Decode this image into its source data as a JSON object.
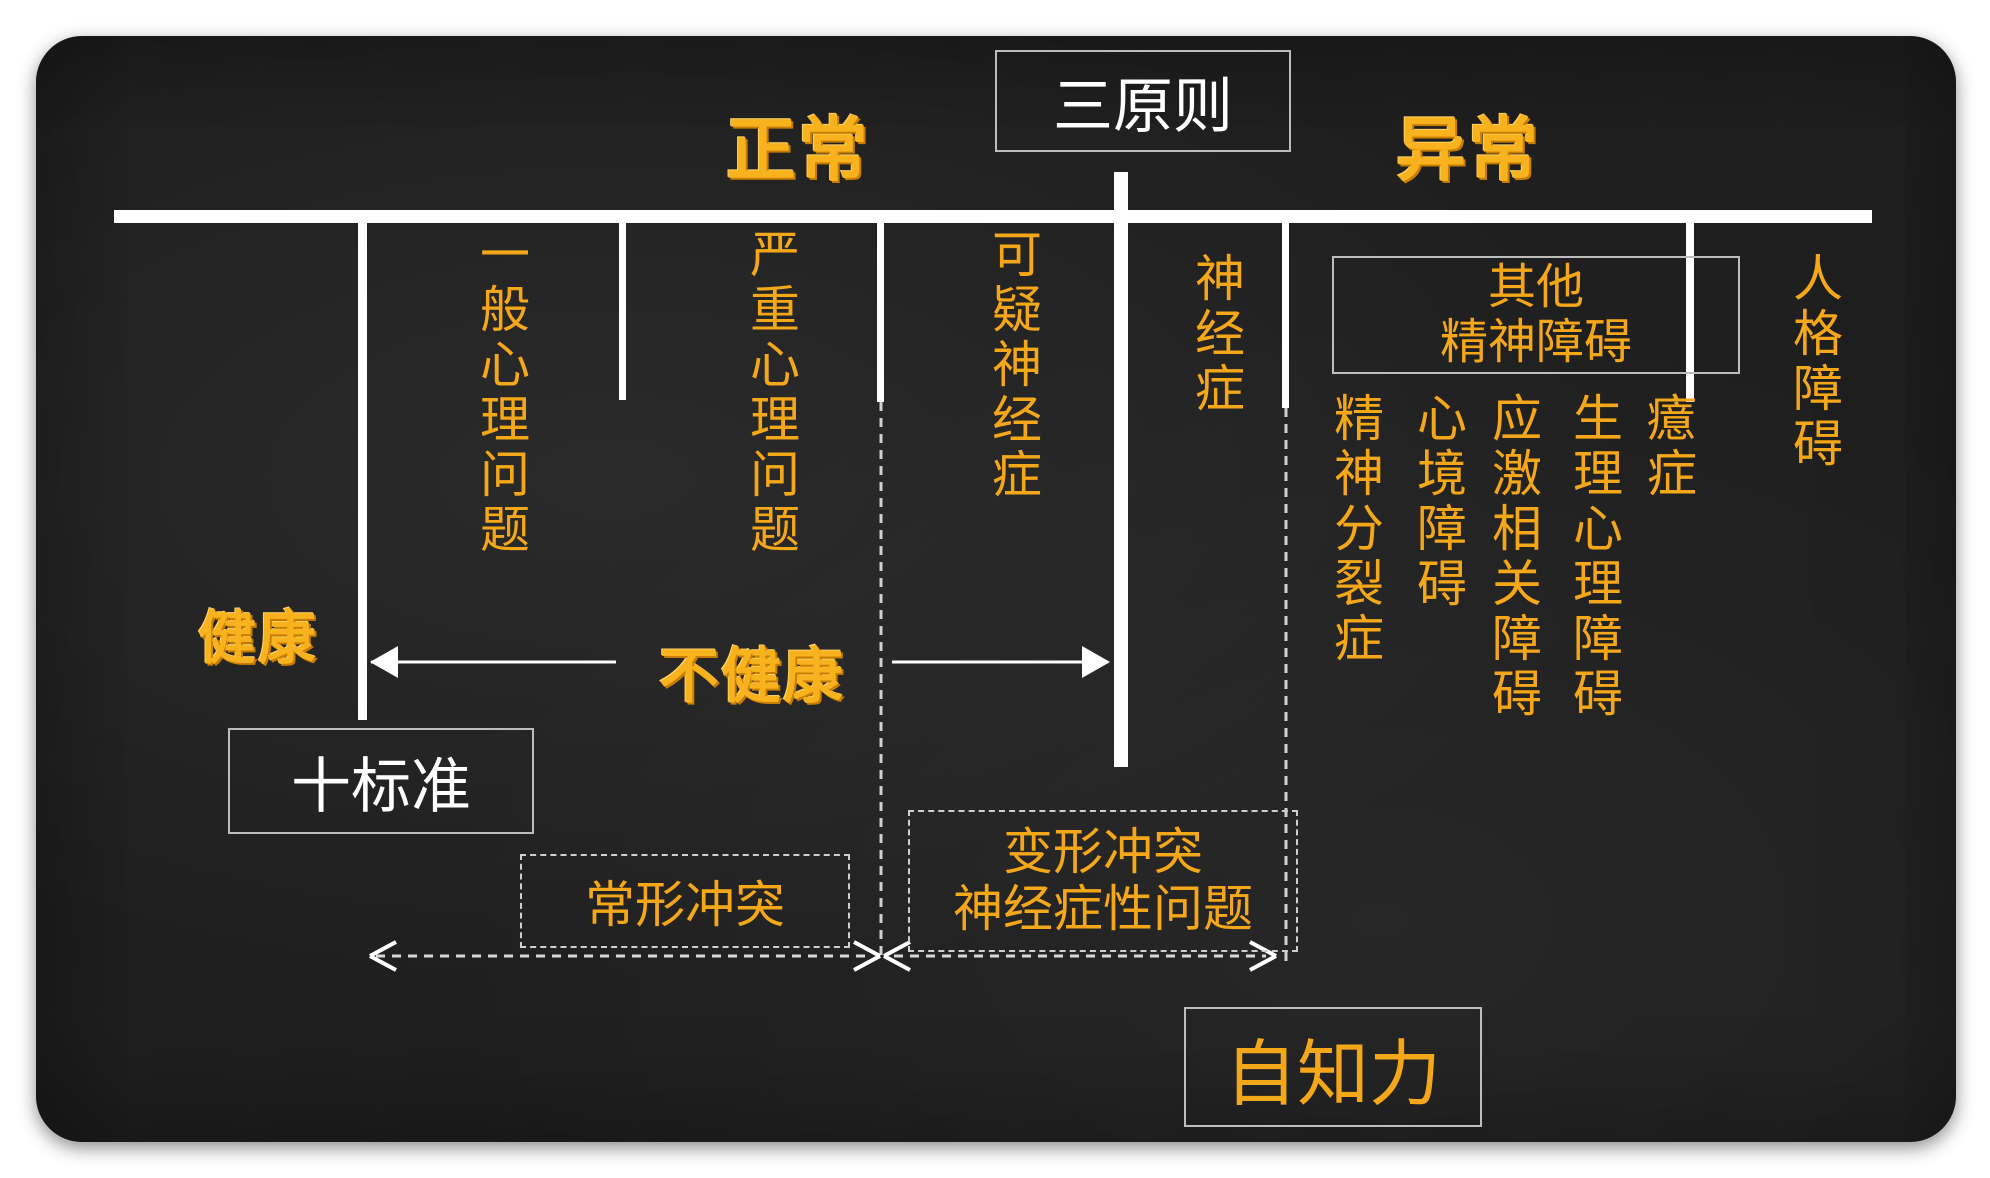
{
  "title_box": "三原则",
  "normal_label": "正常",
  "abnormal_label": "异常",
  "health_label": "健康",
  "unhealthy_label": "不健康",
  "ten_standards": "十标准",
  "self_awareness": "自知力",
  "conflict_normal": "常形冲突",
  "conflict_deformed_line1": "变形冲突",
  "conflict_deformed_line2": "神经症性问题",
  "other_disorders_line1": "其他",
  "other_disorders_line2": "精神障碍",
  "categories": {
    "general_psych": "一般心理问题",
    "serious_psych": "严重心理问题",
    "suspected_neurosis": "可疑神经症",
    "neurosis": "神经症",
    "personality_disorder": "人格障碍",
    "schizophrenia": "精神分裂症",
    "mood_disorder": "心境障碍",
    "stress_disorder": "应激相关障碍",
    "physio_disorder": "生理心理障碍",
    "hysteria": "癔症"
  },
  "colors": {
    "accent": "#f5a71a",
    "board": "#1f1f1f",
    "line": "#ffffff"
  }
}
